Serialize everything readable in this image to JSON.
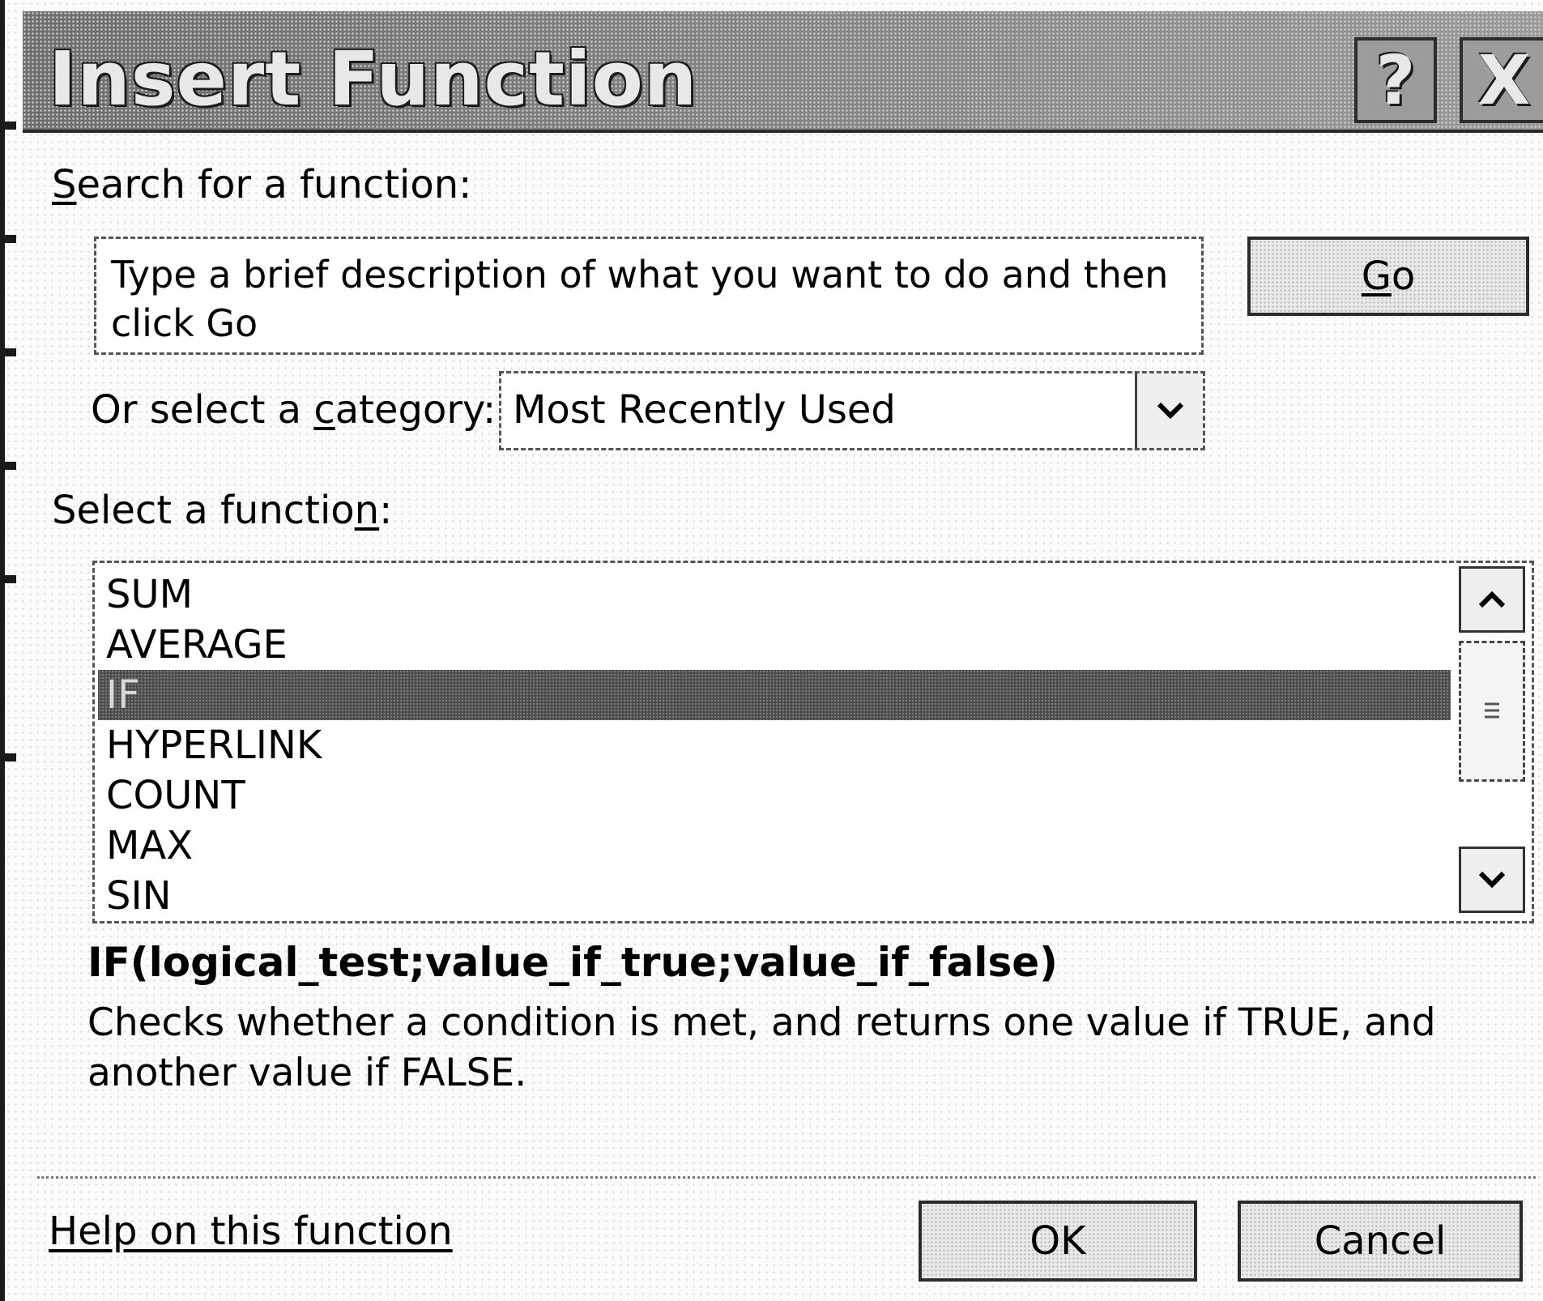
{
  "title": "Insert Function",
  "titlebar": {
    "help_label": "?",
    "close_label": "X"
  },
  "search": {
    "label_first": "S",
    "label_rest": "earch for a function:",
    "placeholder": "Type a brief description of what you want to do and then click Go",
    "go_first": "G",
    "go_rest": "o"
  },
  "category": {
    "label_pre": "Or select a ",
    "label_u": "c",
    "label_post": "ategory:",
    "selected": "Most Recently Used"
  },
  "functions": {
    "label_pre": "Select a functio",
    "label_u": "n",
    "label_post": ":",
    "items": [
      "SUM",
      "AVERAGE",
      "IF",
      "HYPERLINK",
      "COUNT",
      "MAX",
      "SIN"
    ],
    "selected_index": 2
  },
  "details": {
    "syntax": "IF(logical_test;value_if_true;value_if_false)",
    "description": "Checks whether a condition is met, and returns one value if TRUE, and another value if FALSE."
  },
  "footer": {
    "help_link": "Help on this function",
    "ok_label": "OK",
    "cancel_label": "Cancel"
  }
}
